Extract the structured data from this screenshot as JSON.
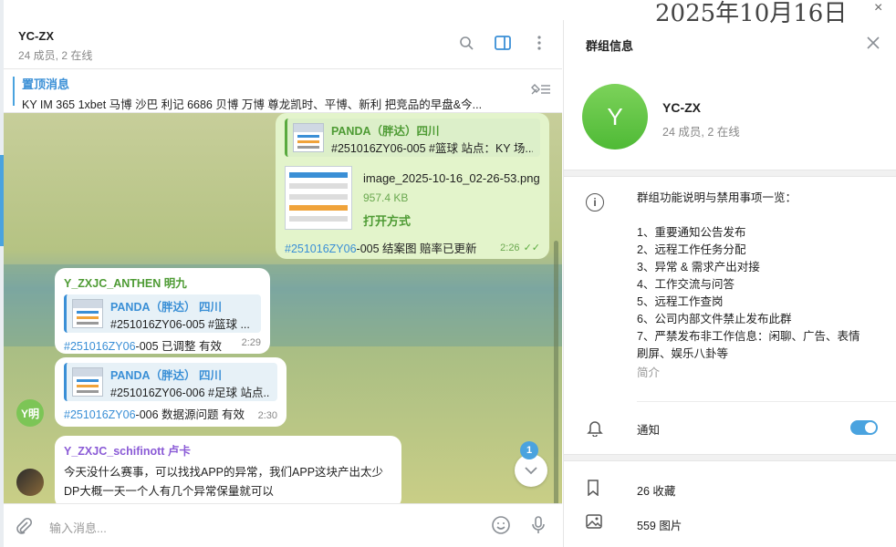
{
  "overlay": {
    "date": "2025年10月16日",
    "close": "×"
  },
  "chat": {
    "title": "YC-ZX",
    "subtitle": "24 成员, 2 在线",
    "pinned": {
      "title": "置顶消息",
      "text": "KY  IM 365 1xbet 马博 沙巴 利记 6686 贝博 万博 尊龙凯时、平博、新利 把竞品的早盘&今..."
    },
    "messages": [
      {
        "reply_name": "PANDA（胖达）四川",
        "reply_text": "#251016ZY06-005 #篮球 站点：KY 场...",
        "file_name": "image_2025-10-16_02-26-53.png",
        "file_size": "957.4 KB",
        "file_action": "打开方式",
        "tag": "#251016ZY06",
        "text": "-005  结案图  赔率已更新",
        "time": "2:26",
        "check": "✓✓"
      },
      {
        "sender": "Y_ZXJC_ANTHEN 明九",
        "reply_name": "PANDA（胖达） 四川",
        "reply_text": "#251016ZY06-005 #篮球 ...",
        "tag": "#251016ZY06",
        "text": "-005 已调整 有效",
        "time": "2:29"
      },
      {
        "reply_name": "PANDA（胖达） 四川",
        "reply_text": "#251016ZY06-006 #足球 站点...",
        "tag": "#251016ZY06",
        "text": "-006 数据源问题 有效",
        "time": "2:30",
        "avatar": "Y明"
      },
      {
        "sender": "Y_ZXJC_schifinott 卢卡",
        "line1": "今天没什么赛事，可以找找APP的异常，我们APP这块产出太少",
        "line2": "DP大概一天一个人有几个异常保量就可以"
      }
    ],
    "unread": "1",
    "compose_placeholder": "输入消息..."
  },
  "info": {
    "header": "群组信息",
    "avatar_letter": "Y",
    "name": "YC-ZX",
    "subtitle": "24 成员, 2 在线",
    "description": [
      "群组功能说明与禁用事项一览：",
      "",
      "1、重要通知公告发布",
      "2、远程工作任务分配",
      "3、异常 & 需求产出对接",
      "4、工作交流与问答",
      "5、远程工作查岗",
      "6、公司内部文件禁止发布此群",
      "7、严禁发布非工作信息：闲聊、广告、表情",
      "刷屏、娱乐八卦等"
    ],
    "description_label": "简介",
    "notify_label": "通知",
    "media": [
      {
        "icon": "bookmark-icon",
        "label": "26 收藏"
      },
      {
        "icon": "image-icon",
        "label": "559 图片"
      }
    ]
  },
  "colors": {
    "accent": "#4aa3df",
    "green": "#4fba36"
  }
}
